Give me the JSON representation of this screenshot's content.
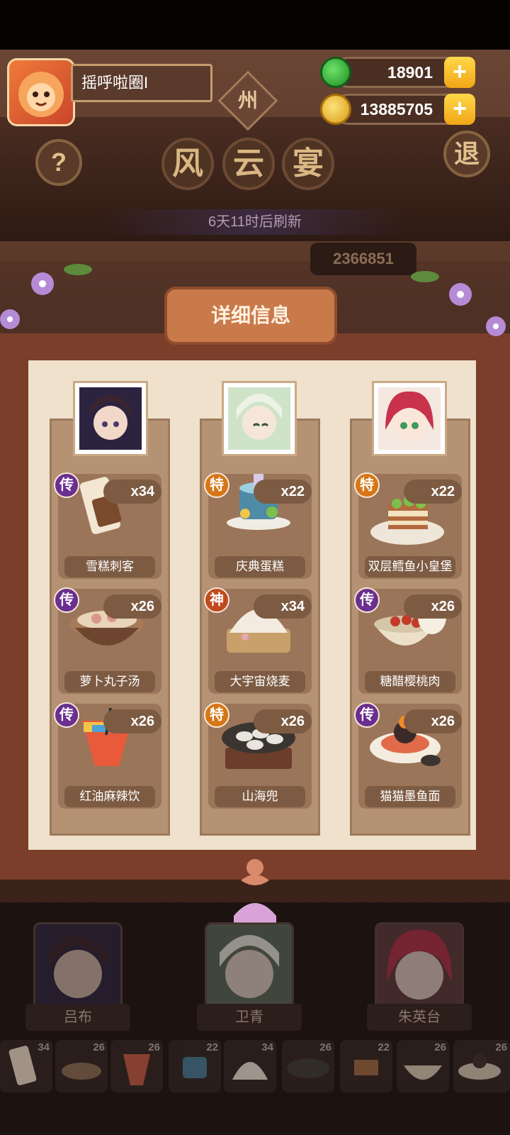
{
  "player": {
    "name": "摇呼啦圈I"
  },
  "header": {
    "sign_char": "州",
    "title_chars": [
      "风",
      "云",
      "宴"
    ],
    "refresh_text": "6天11时后刷新",
    "score": "2366851"
  },
  "currency": {
    "jade": "18901",
    "coins": "13885705"
  },
  "buttons": {
    "help": "?",
    "exit": "退",
    "detail": "详细信息"
  },
  "columns": [
    {
      "character": "吕布",
      "dishes": [
        {
          "name": "雪糕刺客",
          "count": "x34",
          "grade": "传"
        },
        {
          "name": "萝卜丸子汤",
          "count": "x26",
          "grade": "传"
        },
        {
          "name": "红油麻辣饮",
          "count": "x26",
          "grade": "传"
        }
      ]
    },
    {
      "character": "卫青",
      "dishes": [
        {
          "name": "庆典蛋糕",
          "count": "x22",
          "grade": "特"
        },
        {
          "name": "大宇宙烧麦",
          "count": "x34",
          "grade": "神"
        },
        {
          "name": "山海兜",
          "count": "x26",
          "grade": "特"
        }
      ]
    },
    {
      "character": "朱英台",
      "dishes": [
        {
          "name": "双层鳕鱼小皇堡",
          "count": "x22",
          "grade": "特"
        },
        {
          "name": "糖醋樱桃肉",
          "count": "x26",
          "grade": "传"
        },
        {
          "name": "猫猫墨鱼面",
          "count": "x26",
          "grade": "传"
        }
      ]
    }
  ],
  "bottom_slots": [
    "34",
    "26",
    "26",
    "22",
    "34",
    "26",
    "22",
    "26",
    "26"
  ],
  "colors": {
    "wood": "#7a3e2a",
    "paper": "#efe1cc",
    "legendary": "#6b2f8f",
    "special": "#d67618",
    "divine": "#c04a1f"
  }
}
